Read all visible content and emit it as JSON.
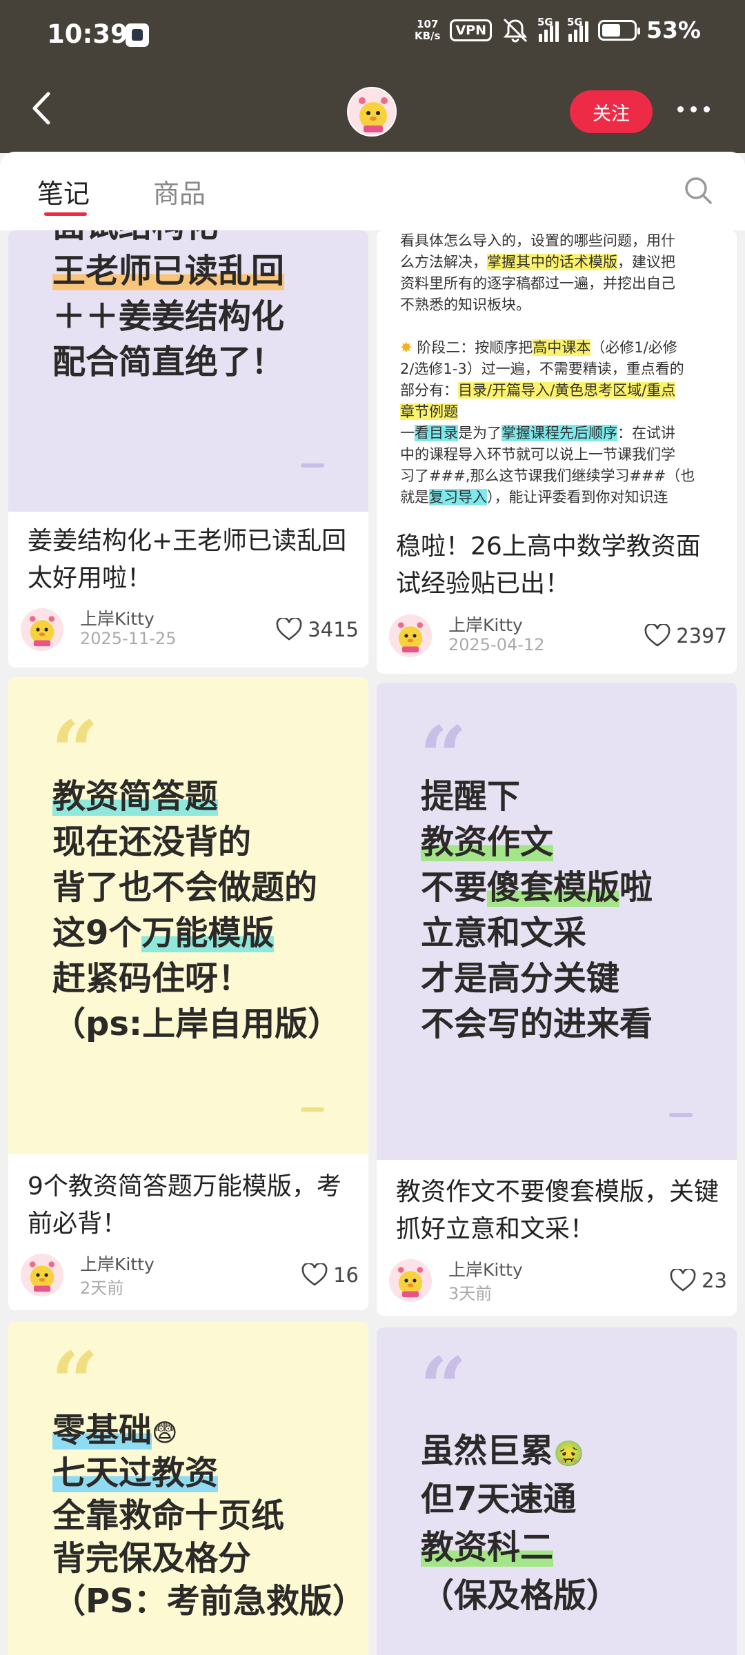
{
  "status": {
    "time": "10:39",
    "net_speed_value": "107",
    "net_speed_unit": "KB/s",
    "vpn": "VPN",
    "sim1": "5G",
    "sim2": "5G",
    "battery": "53%"
  },
  "nav": {
    "follow_label": "关注"
  },
  "tabs": [
    {
      "label": "笔记",
      "active": true
    },
    {
      "label": "商品",
      "active": false
    }
  ],
  "cards": [
    {
      "cover_lines": [
        "面试结构化",
        "王老师已读乱回",
        "＋＋姜姜结构化",
        "配合简直绝了！"
      ],
      "title": "姜姜结构化+王老师已读乱回 太好用啦！",
      "author": "上岸Kitty",
      "date": "2025-11-25",
      "likes": "3415"
    },
    {
      "doc": {
        "l1": "看具体怎么导入的，设置的哪些问题，用什",
        "l2a": "么方法解决，",
        "l2b": "掌握其中的话术模版",
        "l2c": "，建议把",
        "l3": "资料里所有的逐字稿都过一遍，并挖出自己",
        "l4": "不熟悉的知识板块。",
        "l5a": "阶段二：按顺序把",
        "l5b": "高中课本",
        "l5c": "（必修1/必修",
        "l6": "2/选修1-3）过一遍，不需要精读，重点看的",
        "l7a": "部分有：",
        "l7b": "目录/开篇导入/黄色思考区域/重点",
        "l8": "章节例题",
        "l9a": "一",
        "l9b": "看目录",
        "l9c": "是为了",
        "l9d": "掌握课程先后顺序",
        "l9e": "：在试讲",
        "l10": "中的课程导入环节就可以说上一节课我们学",
        "l11": "习了###,那么这节课我们继续学习###（也",
        "l12a": "就是",
        "l12b": "复习导入",
        "l12c": "），能让评委看到你对知识连"
      },
      "title": "稳啦！26上高中数学教资面试经验贴已出！",
      "author": "上岸Kitty",
      "date": "2025-04-12",
      "likes": "2397"
    },
    {
      "cover_lines": [
        "教资简答题",
        "现在还没背的",
        "背了也不会做题的",
        "这9个",
        "万能模版",
        "赶紧码住呀！",
        "（ps:上岸自用版）"
      ],
      "title": "9个教资简答题万能模版，考前必背！",
      "author": "上岸Kitty",
      "date": "2天前",
      "likes": "16"
    },
    {
      "cover_lines": [
        "提醒下",
        "教资作文",
        "不要",
        "傻套模版",
        "啦",
        "立意和文采",
        "才是高分关键",
        "不会写的进来看"
      ],
      "title": "教资作文不要傻套模版，关键抓好立意和文采！",
      "author": "上岸Kitty",
      "date": "3天前",
      "likes": "23"
    },
    {
      "cover_lines": [
        "零基础",
        "七天过教资",
        "全靠救命十页纸",
        "背完保及格分",
        "（PS：考前急救版）"
      ],
      "emoji": "😨"
    },
    {
      "cover_lines": [
        "虽然巨累",
        "但7天速通",
        "教资科二",
        "（保及格版）"
      ],
      "emoji": "🤢"
    }
  ]
}
